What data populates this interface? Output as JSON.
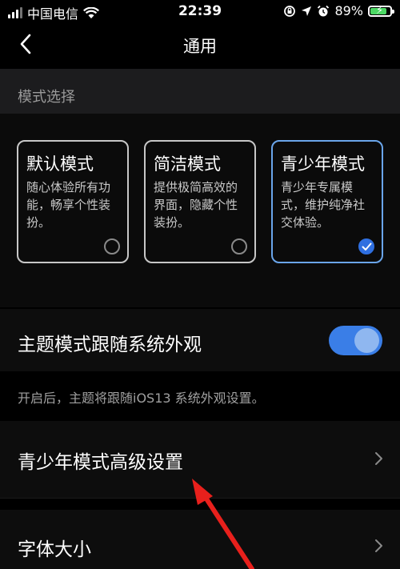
{
  "status_bar": {
    "carrier": "中国电信",
    "time": "22:39",
    "battery": "89%",
    "icons": [
      "signal-icon",
      "wifi-icon",
      "location-icon",
      "alarm-icon",
      "battery-icon"
    ]
  },
  "nav": {
    "title": "通用"
  },
  "mode_section": {
    "header": "模式选择",
    "cards": [
      {
        "title": "默认模式",
        "desc": "随心体验所有功能，畅享个性装扮。",
        "selected": false
      },
      {
        "title": "简洁模式",
        "desc": "提供极简高效的界面，隐藏个性装扮。",
        "selected": false
      },
      {
        "title": "青少年模式",
        "desc": "青少年专属模式，维护纯净社交体验。",
        "selected": true
      }
    ]
  },
  "theme_row": {
    "label": "主题模式跟随系统外观",
    "enabled": true
  },
  "theme_hint": "开启后，主题将跟随iOS13 系统外观设置。",
  "teen_settings": {
    "label": "青少年模式高级设置"
  },
  "font_size": {
    "label": "字体大小"
  },
  "colors": {
    "accent": "#3a7ee7",
    "selected_border": "#6aa5ea",
    "annotation_arrow": "#e8201c"
  }
}
